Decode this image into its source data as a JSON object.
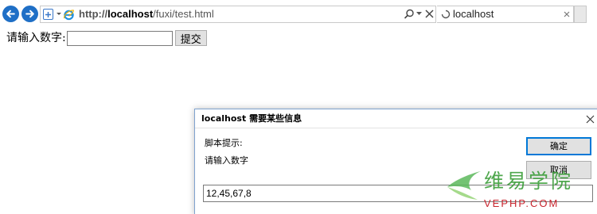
{
  "browser": {
    "url_protocol": "http://",
    "url_host": "localhost",
    "url_path": "/fuxi/test.html",
    "tab_title": "localhost"
  },
  "page": {
    "prompt_label": "请输入数字:",
    "input_value": "",
    "submit_label": "提交"
  },
  "dialog": {
    "title": "localhost 需要某些信息",
    "script_prompt_label": "脚本提示:",
    "message": "请输入数字",
    "ok_label": "确定",
    "cancel_label": "取消",
    "input_value": "12,45,67,8"
  },
  "watermark": {
    "text_cn": "维易学院",
    "text_en": "VEPHP.COM"
  },
  "colors": {
    "nav_blue": "#1f6fc6",
    "dialog_border": "#7fa3cf",
    "default_button_border": "#0078d7",
    "watermark_green": "#3c9e3a",
    "watermark_red": "#c8232c"
  }
}
